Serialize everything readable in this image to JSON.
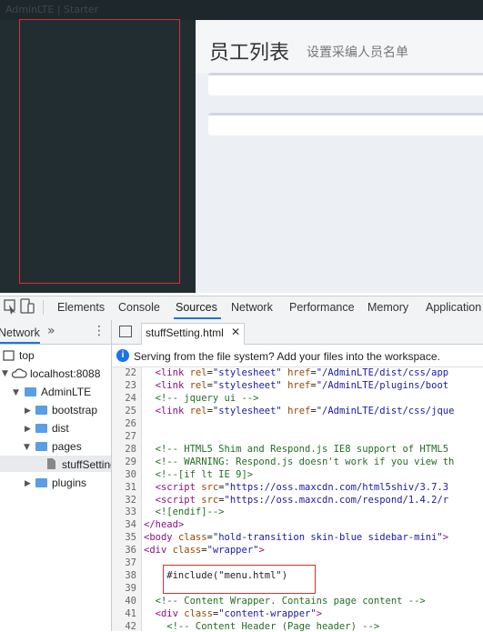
{
  "page": {
    "ghost_title": "AdminLTE | Starter",
    "title": "员工列表",
    "subtitle": "设置采编人员名单"
  },
  "devtools": {
    "tabs": [
      "Elements",
      "Console",
      "Sources",
      "Network",
      "Performance",
      "Memory",
      "Application"
    ],
    "active_tab": "Sources",
    "navigator": {
      "tab": "Network",
      "tree": {
        "top": "top",
        "host": "localhost:8088",
        "adminlte": "AdminLTE",
        "bootstrap": "bootstrap",
        "dist": "dist",
        "pages": "pages",
        "file": "stuffSetting.html",
        "plugins": "plugins"
      }
    },
    "editor": {
      "file_tab": "stuffSetting.html",
      "info": "Serving from the file system? Add your files into the workspace.",
      "lines": [
        {
          "n": "22",
          "text": "  <link rel=\"stylesheet\" href=\"/AdminLTE/dist/css/app"
        },
        {
          "n": "23",
          "text": "  <link rel=\"stylesheet\" href=\"/AdminLTE/plugins/boot"
        },
        {
          "n": "24",
          "text": "  <!-- jquery ui -->"
        },
        {
          "n": "25",
          "text": "  <link rel=\"stylesheet\" href=\"/AdminLTE/dist/css/jque"
        },
        {
          "n": "26",
          "text": ""
        },
        {
          "n": "27",
          "text": ""
        },
        {
          "n": "28",
          "text": "  <!-- HTML5 Shim and Respond.js IE8 support of HTML5"
        },
        {
          "n": "29",
          "text": "  <!-- WARNING: Respond.js doesn't work if you view th"
        },
        {
          "n": "30",
          "text": "  <!--[if lt IE 9]>"
        },
        {
          "n": "31",
          "text": "  <script src=\"https://oss.maxcdn.com/html5shiv/3.7.3"
        },
        {
          "n": "32",
          "text": "  <script src=\"https://oss.maxcdn.com/respond/1.4.2/r"
        },
        {
          "n": "33",
          "text": "  <![endif]-->"
        },
        {
          "n": "34",
          "text": "</head>"
        },
        {
          "n": "35",
          "text": "<body class=\"hold-transition skin-blue sidebar-mini\">"
        },
        {
          "n": "36",
          "text": "<div class=\"wrapper\">"
        },
        {
          "n": "37",
          "text": ""
        },
        {
          "n": "38",
          "text": "    #include(\"menu.html\")"
        },
        {
          "n": "39",
          "text": ""
        },
        {
          "n": "40",
          "text": "  <!-- Content Wrapper. Contains page content -->"
        },
        {
          "n": "41",
          "text": "  <div class=\"content-wrapper\">"
        },
        {
          "n": "42",
          "text": "    <!-- Content Header (Page header) -->"
        }
      ]
    }
  },
  "colors": {
    "accent": "#1a73e8",
    "highlight_box": "#d9302a",
    "sidebar": "#222d32"
  }
}
